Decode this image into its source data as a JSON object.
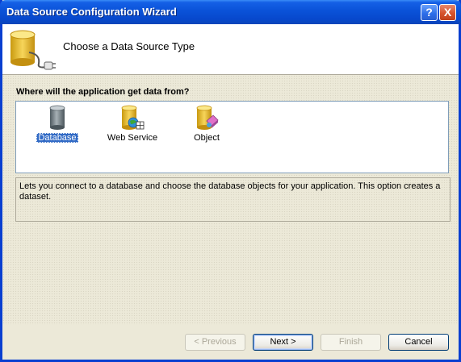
{
  "window": {
    "title": "Data Source Configuration Wizard"
  },
  "title_buttons": {
    "help": "?",
    "close": "X"
  },
  "header": {
    "title": "Choose a Data Source Type",
    "icon": "database-plug-icon"
  },
  "prompt": "Where will the application get data from?",
  "data_source_types": [
    {
      "label": "Database",
      "icon": "database-icon",
      "selected": true
    },
    {
      "label": "Web Service",
      "icon": "web-service-icon",
      "selected": false
    },
    {
      "label": "Object",
      "icon": "object-icon",
      "selected": false
    }
  ],
  "description": "Lets you connect to a database and choose the database objects for your application. This option creates a dataset.",
  "buttons": {
    "previous": {
      "label": "< Previous",
      "enabled": false
    },
    "next": {
      "label": "Next >",
      "enabled": true
    },
    "finish": {
      "label": "Finish",
      "enabled": false
    },
    "cancel": {
      "label": "Cancel",
      "enabled": true
    }
  },
  "colors": {
    "title_bar": "#0a52d8",
    "selection": "#316ac5",
    "dialog_bg": "#ece9d8"
  }
}
